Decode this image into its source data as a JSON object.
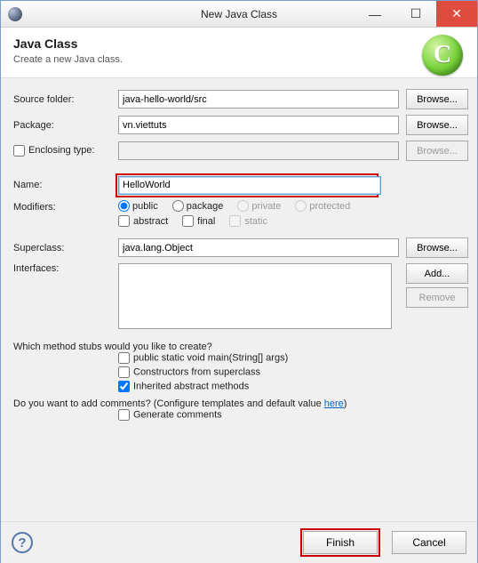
{
  "window": {
    "title": "New Java Class"
  },
  "header": {
    "title": "Java Class",
    "subtitle": "Create a new Java class."
  },
  "fields": {
    "source_folder_label": "Source folder:",
    "source_folder_value": "java-hello-world/src",
    "package_label": "Package:",
    "package_value": "vn.viettuts",
    "enclosing_type_label": "Enclosing type:",
    "enclosing_type_value": "",
    "name_label": "Name:",
    "name_value": "HelloWorld",
    "modifiers_label": "Modifiers:",
    "mod_public": "public",
    "mod_package": "package",
    "mod_private": "private",
    "mod_protected": "protected",
    "mod_abstract": "abstract",
    "mod_final": "final",
    "mod_static": "static",
    "superclass_label": "Superclass:",
    "superclass_value": "java.lang.Object",
    "interfaces_label": "Interfaces:"
  },
  "buttons": {
    "browse": "Browse...",
    "add": "Add...",
    "remove": "Remove",
    "finish": "Finish",
    "cancel": "Cancel"
  },
  "stubs": {
    "question": "Which method stubs would you like to create?",
    "main": "public static void main(String[] args)",
    "constructors": "Constructors from superclass",
    "inherited": "Inherited abstract methods"
  },
  "comments": {
    "question_prefix": "Do you want to add comments? (Configure templates and default value ",
    "link": "here",
    "question_suffix": ")",
    "generate": "Generate comments"
  }
}
